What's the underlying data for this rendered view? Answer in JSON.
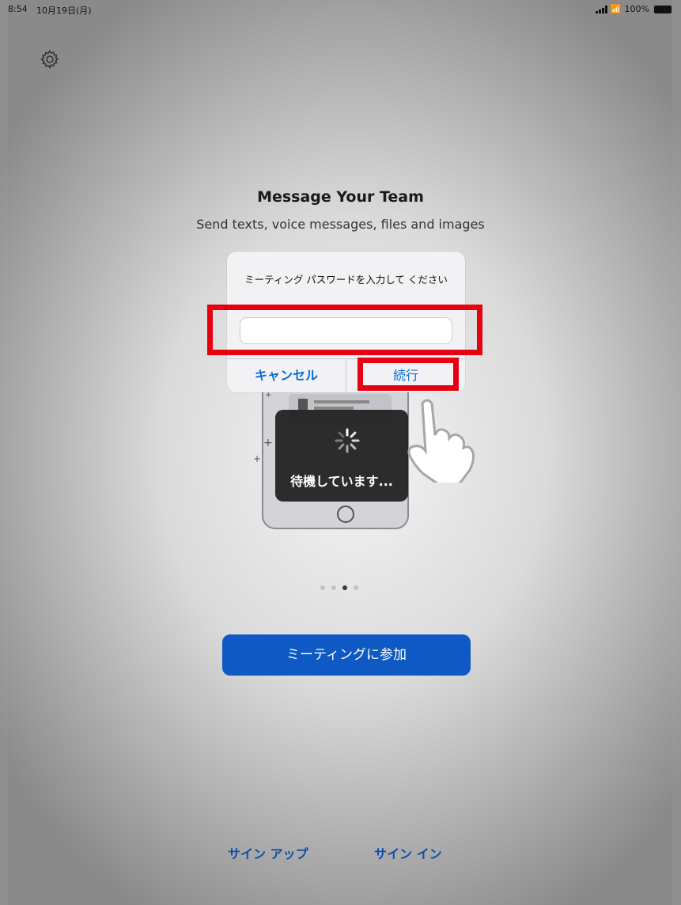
{
  "status_bar": {
    "time": "8:54",
    "date": "10月19日(月)",
    "battery": "100%"
  },
  "onboarding": {
    "title": "Message Your Team",
    "subtitle": "Send texts, voice messages, files and images",
    "page_count": 4,
    "active_page_index": 2
  },
  "password_dialog": {
    "message": "ミーティング パスワードを入力して ください",
    "input_value": "",
    "cancel_label": "キャンセル",
    "continue_label": "続行"
  },
  "loading_hud": {
    "text": "待機しています..."
  },
  "join_meeting_button": {
    "label": "ミーティングに参加",
    "color": "#0e59c3"
  },
  "footer": {
    "signup_label": "サイン アップ",
    "signin_label": "サイン イン"
  },
  "annotation": {
    "highlight_color": "#e60012"
  },
  "accent_color": "#0a6cd5"
}
